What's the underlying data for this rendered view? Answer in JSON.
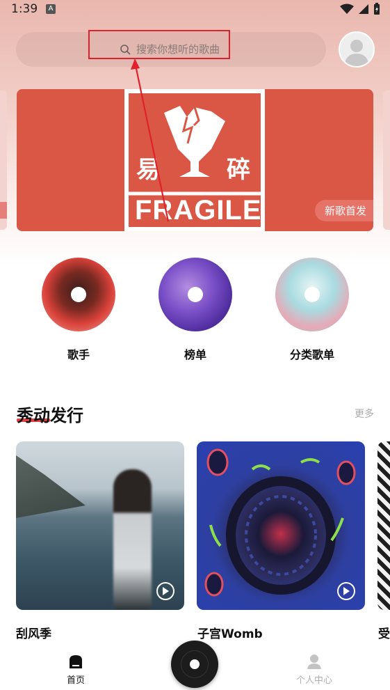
{
  "status_bar": {
    "time": "1:39",
    "a_badge": "A",
    "icons": [
      "wifi-icon",
      "signal-icon",
      "battery-icon"
    ]
  },
  "search": {
    "placeholder": "搜索你想听的歌曲",
    "icon": "search-icon"
  },
  "banner": {
    "art_text_left": "易",
    "art_text_right": "碎",
    "art_text_bottom": "FRAGILE",
    "badge": "新歌首发"
  },
  "categories": [
    {
      "label": "歌手"
    },
    {
      "label": "榜单"
    },
    {
      "label": "分类歌单"
    }
  ],
  "section": {
    "title": "秀动发行",
    "more": "更多"
  },
  "albums": [
    {
      "title": "刮风季"
    },
    {
      "title": "子宫Womb"
    },
    {
      "title": "受"
    }
  ],
  "bottom_nav": {
    "home": "首页",
    "profile": "个人中心"
  },
  "colors": {
    "accent_red": "#e34040",
    "banner_red": "#d95744",
    "annotation_red": "#e0202a"
  }
}
